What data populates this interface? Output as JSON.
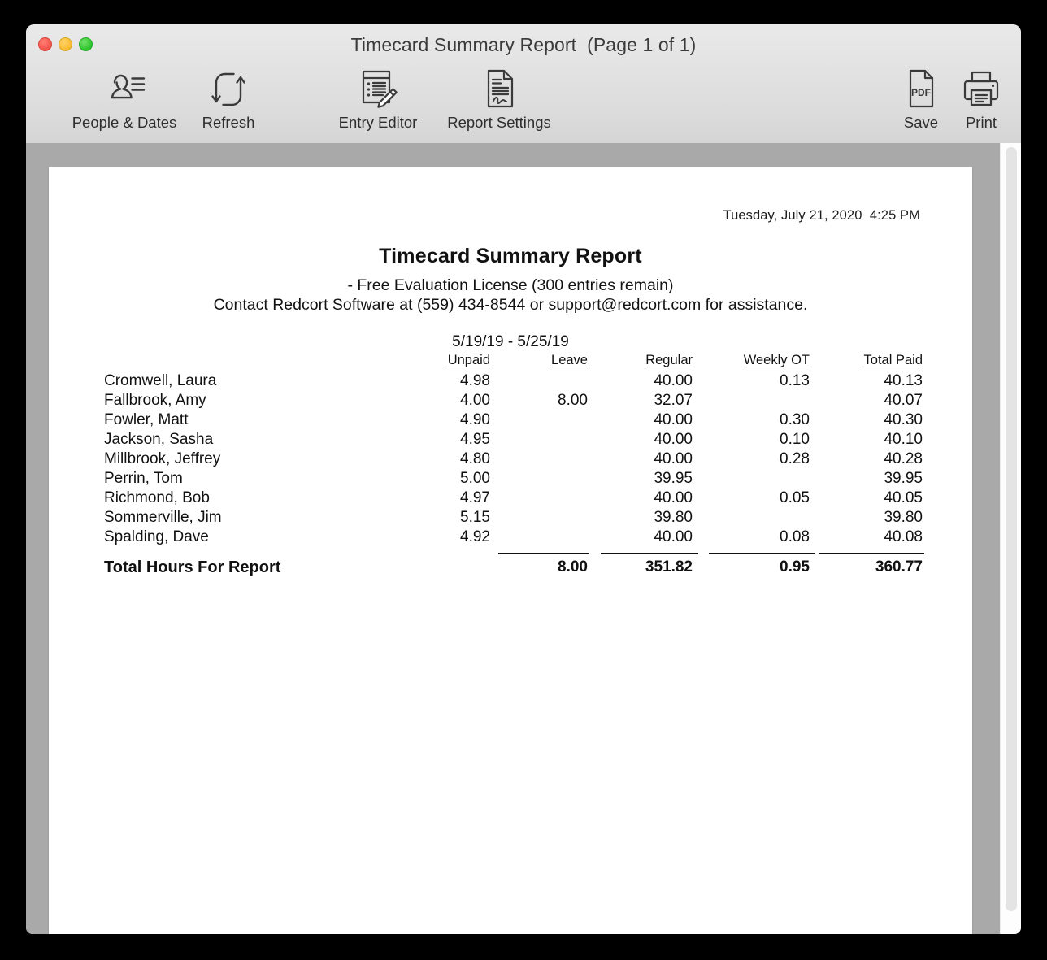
{
  "window": {
    "title": "Timecard Summary Report  (Page 1 of 1)",
    "traffic_lights": [
      {
        "name": "close",
        "color": "#f5564c"
      },
      {
        "name": "minimize",
        "color": "#f9bd35"
      },
      {
        "name": "zoom",
        "color": "#34c831"
      }
    ]
  },
  "toolbar": {
    "items": [
      {
        "id": "people-dates",
        "label": "People & Dates",
        "icon": "person-lines-icon"
      },
      {
        "id": "refresh",
        "label": "Refresh",
        "icon": "refresh-loop-icon"
      },
      {
        "id": "entry-editor",
        "label": "Entry Editor",
        "icon": "document-pencil-icon"
      },
      {
        "id": "report-settings",
        "label": "Report Settings",
        "icon": "document-signature-icon"
      },
      {
        "id": "save",
        "label": "Save",
        "icon": "pdf-document-icon"
      },
      {
        "id": "print",
        "label": "Print",
        "icon": "printer-icon"
      }
    ]
  },
  "report": {
    "generated": "Tuesday, July 21, 2020  4:25 PM",
    "title": "Timecard Summary Report",
    "license": "- Free Evaluation License (300 entries remain)",
    "contact": "Contact Redcort Software at (559) 434-8544 or support@redcort.com for assistance.",
    "date_range": "5/19/19 - 5/25/19",
    "columns": [
      "",
      "Unpaid",
      "Leave",
      "Regular",
      "Weekly OT",
      "Total Paid"
    ],
    "rows": [
      {
        "name": "Cromwell, Laura",
        "unpaid": "4.98",
        "leave": "",
        "regular": "40.00",
        "weekly_ot": "0.13",
        "total_paid": "40.13"
      },
      {
        "name": "Fallbrook, Amy",
        "unpaid": "4.00",
        "leave": "8.00",
        "regular": "32.07",
        "weekly_ot": "",
        "total_paid": "40.07"
      },
      {
        "name": "Fowler, Matt",
        "unpaid": "4.90",
        "leave": "",
        "regular": "40.00",
        "weekly_ot": "0.30",
        "total_paid": "40.30"
      },
      {
        "name": "Jackson, Sasha",
        "unpaid": "4.95",
        "leave": "",
        "regular": "40.00",
        "weekly_ot": "0.10",
        "total_paid": "40.10"
      },
      {
        "name": "Millbrook, Jeffrey",
        "unpaid": "4.80",
        "leave": "",
        "regular": "40.00",
        "weekly_ot": "0.28",
        "total_paid": "40.28"
      },
      {
        "name": "Perrin, Tom",
        "unpaid": "5.00",
        "leave": "",
        "regular": "39.95",
        "weekly_ot": "",
        "total_paid": "39.95"
      },
      {
        "name": "Richmond, Bob",
        "unpaid": "4.97",
        "leave": "",
        "regular": "40.00",
        "weekly_ot": "0.05",
        "total_paid": "40.05"
      },
      {
        "name": "Sommerville, Jim",
        "unpaid": "5.15",
        "leave": "",
        "regular": "39.80",
        "weekly_ot": "",
        "total_paid": "39.80"
      },
      {
        "name": "Spalding, Dave",
        "unpaid": "4.92",
        "leave": "",
        "regular": "40.00",
        "weekly_ot": "0.08",
        "total_paid": "40.08"
      }
    ],
    "total": {
      "label": "Total Hours For Report",
      "unpaid": "",
      "leave": "8.00",
      "regular": "351.82",
      "weekly_ot": "0.95",
      "total_paid": "360.77"
    }
  },
  "scrollbar": {
    "name": "vertical-scrollbar"
  }
}
